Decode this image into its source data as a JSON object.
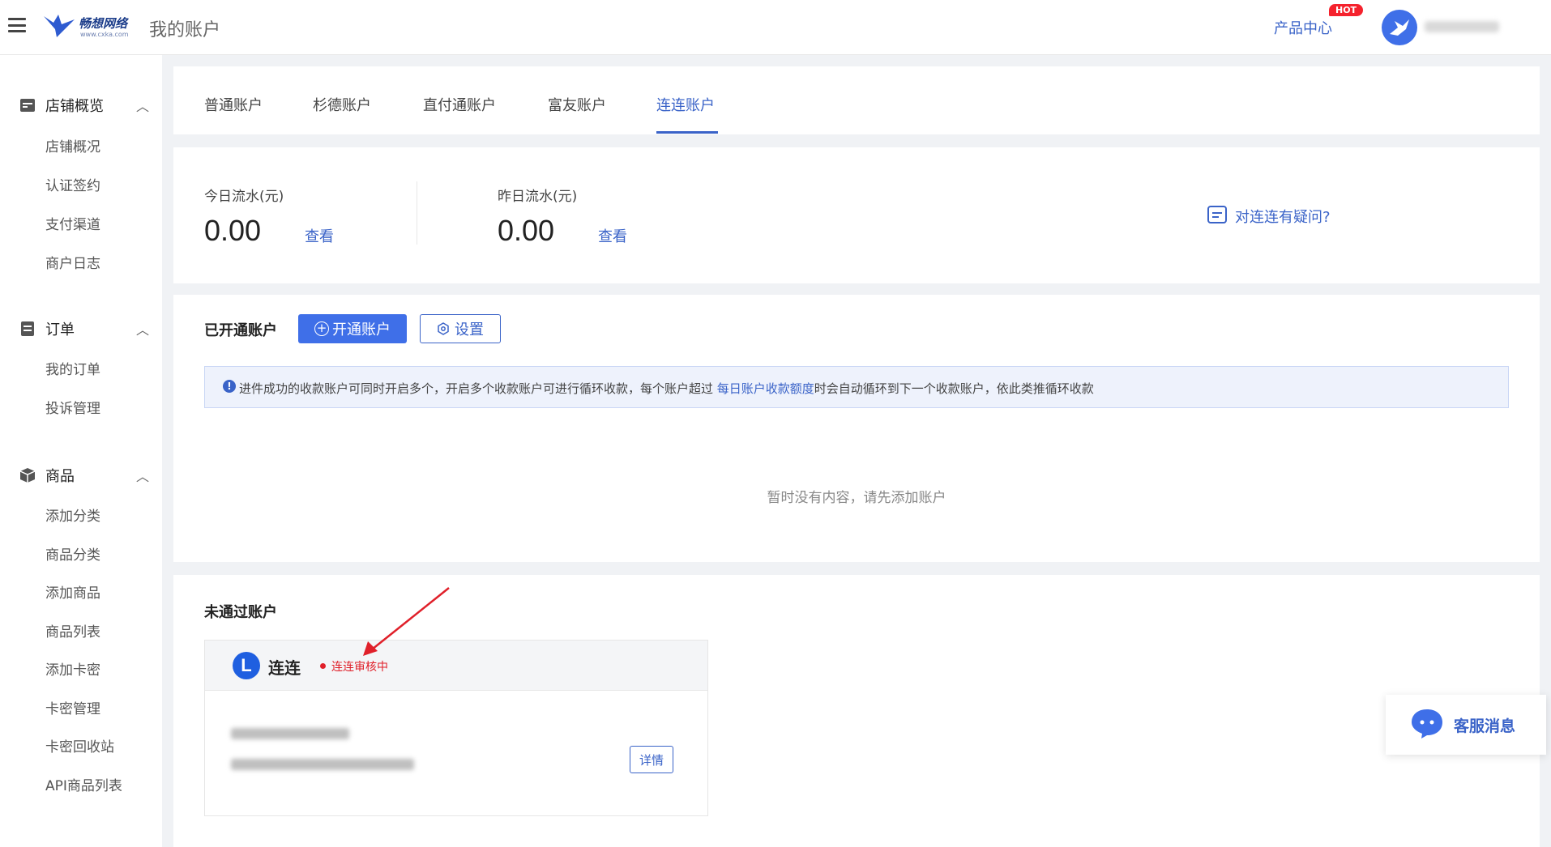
{
  "header": {
    "logo_text": "畅想网络",
    "logo_sub": "www.cxka.com",
    "page_title": "我的账户",
    "product_center": "产品中心",
    "hot_badge": "HOT"
  },
  "sidebar": {
    "groups": [
      {
        "label": "店铺概览",
        "icon": "store-icon",
        "items": [
          "店铺概况",
          "认证签约",
          "支付渠道",
          "商户日志"
        ]
      },
      {
        "label": "订单",
        "icon": "order-icon",
        "items": [
          "我的订单",
          "投诉管理"
        ]
      },
      {
        "label": "商品",
        "icon": "cube-icon",
        "items": [
          "添加分类",
          "商品分类",
          "添加商品",
          "商品列表",
          "添加卡密",
          "卡密管理",
          "卡密回收站",
          "API商品列表"
        ]
      }
    ]
  },
  "tabs": {
    "items": [
      "普通账户",
      "杉德账户",
      "直付通账户",
      "富友账户",
      "连连账户"
    ],
    "active_index": 4
  },
  "stats": {
    "today_label": "今日流水(元)",
    "today_value": "0.00",
    "today_link": "查看",
    "yesterday_label": "昨日流水(元)",
    "yesterday_value": "0.00",
    "yesterday_link": "查看",
    "faq_link": "对连连有疑问?"
  },
  "opened": {
    "title": "已开通账户",
    "open_button": "开通账户",
    "settings_button": "设置",
    "notice_prefix": "进件成功的收款账户可同时开启多个，开启多个收款账户可进行循环收款，每个账户超过 ",
    "notice_link": "每日账户收款额度",
    "notice_suffix": "时会自动循环到下一个收款账户，依此类推循环收款",
    "empty_text": "暂时没有内容，请先添加账户"
  },
  "failed": {
    "title": "未通过账户",
    "card": {
      "provider_logo": "L",
      "provider_name": "连连",
      "status": "连连审核中",
      "detail_button": "详情"
    }
  },
  "service": {
    "label": "客服消息"
  },
  "colors": {
    "accent": "#3a63c8",
    "primary_button": "#3f6fe8",
    "status_red": "#e0202a",
    "hot_red": "#f5222d"
  }
}
